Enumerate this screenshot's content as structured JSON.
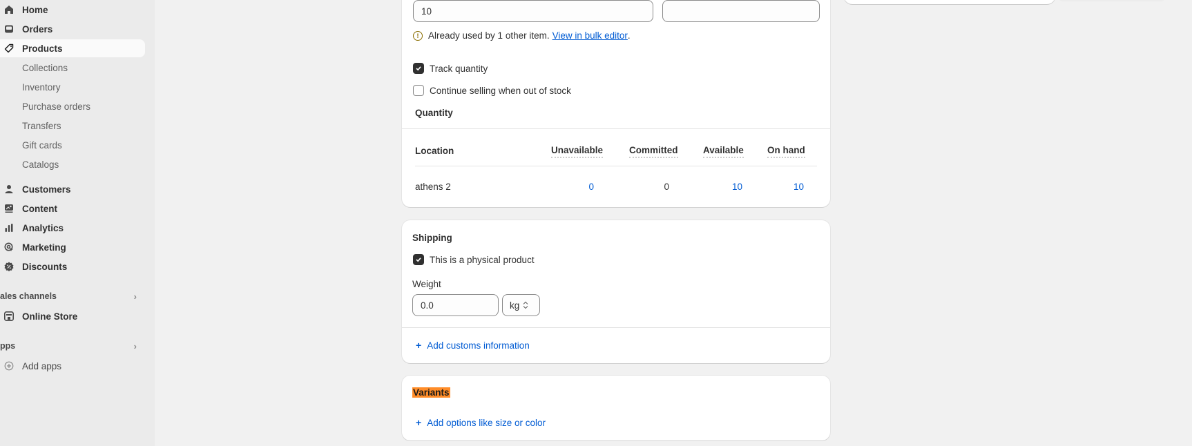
{
  "sidebar": {
    "main_items": [
      {
        "label": "Home",
        "icon": "home-icon"
      },
      {
        "label": "Orders",
        "icon": "inbox-icon"
      },
      {
        "label": "Products",
        "icon": "tag-icon",
        "active": true
      }
    ],
    "product_subitems": [
      "Collections",
      "Inventory",
      "Purchase orders",
      "Transfers",
      "Gift cards",
      "Catalogs"
    ],
    "more_items": [
      {
        "label": "Customers",
        "icon": "person-icon"
      },
      {
        "label": "Content",
        "icon": "content-icon"
      },
      {
        "label": "Analytics",
        "icon": "bar-chart-icon"
      },
      {
        "label": "Marketing",
        "icon": "target-icon"
      },
      {
        "label": "Discounts",
        "icon": "discount-icon"
      }
    ],
    "sales_channels": {
      "label": "ales channels",
      "items": [
        {
          "label": "Online Store",
          "icon": "store-icon"
        }
      ]
    },
    "apps": {
      "label": "pps",
      "items": [
        {
          "label": "Add apps",
          "icon": "plus-circle-icon"
        }
      ]
    }
  },
  "inventory": {
    "sku_value": "10",
    "barcode_value": "",
    "warning": {
      "text": "Already used by 1 other item.",
      "link": "View in bulk editor",
      "suffix": "."
    },
    "track_quantity": {
      "label": "Track quantity",
      "checked": true
    },
    "continue_selling": {
      "label": "Continue selling when out of stock",
      "checked": false
    },
    "quantity_title": "Quantity",
    "table": {
      "headers": [
        "Location",
        "Unavailable",
        "Committed",
        "Available",
        "On hand"
      ],
      "rows": [
        {
          "location": "athens 2",
          "unavailable": "0",
          "committed": "0",
          "available": "10",
          "on_hand": "10"
        }
      ]
    }
  },
  "shipping": {
    "title": "Shipping",
    "physical_product": {
      "label": "This is a physical product",
      "checked": true
    },
    "weight_label": "Weight",
    "weight_value": "0.0",
    "weight_unit": "kg",
    "customs_link": "Add customs information"
  },
  "variants": {
    "title": "Variants",
    "add_options_link": "Add options like size or color"
  },
  "colors": {
    "link": "#005bd3",
    "highlight": "#ff8c28",
    "warning": "#8a6d00"
  }
}
